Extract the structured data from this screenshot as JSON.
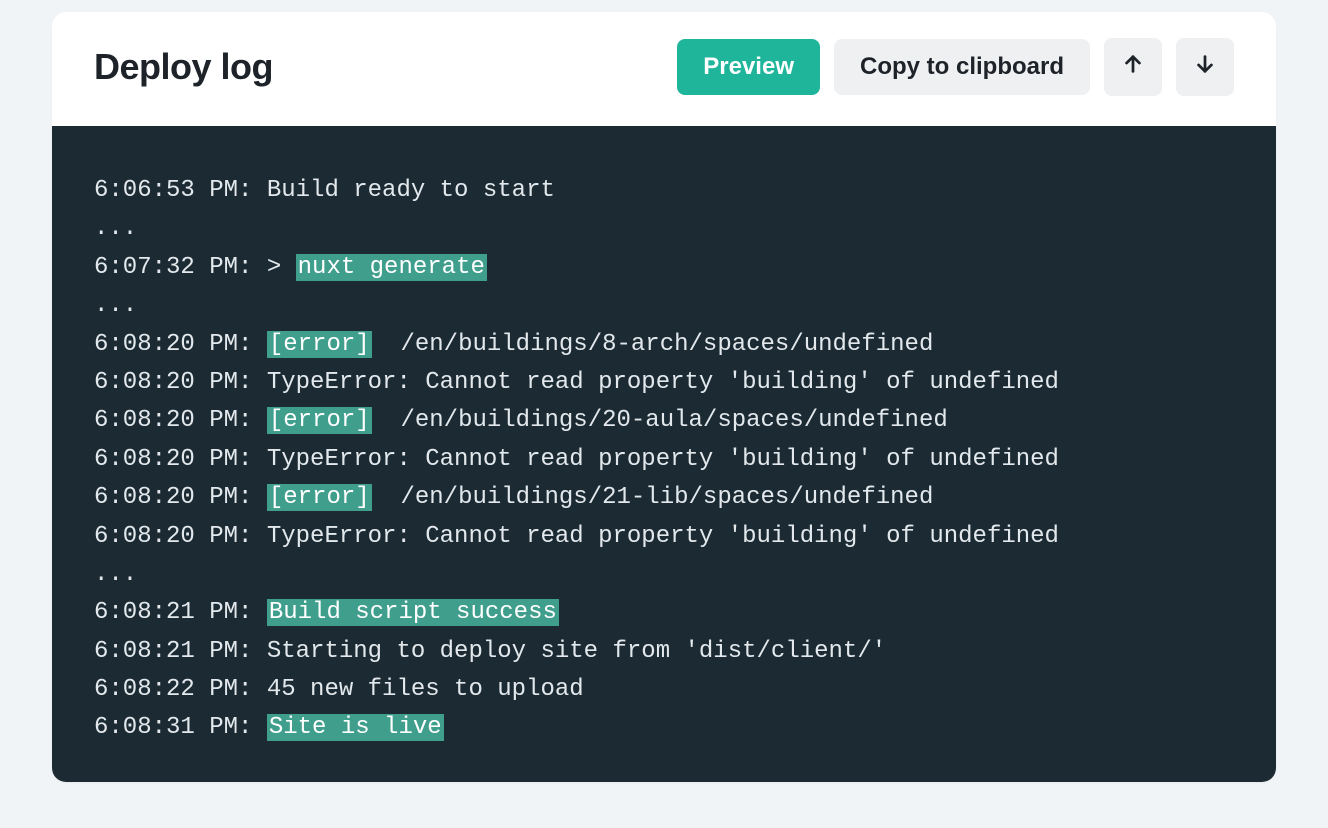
{
  "header": {
    "title": "Deploy log",
    "preview_label": "Preview",
    "copy_label": "Copy to clipboard"
  },
  "log": {
    "lines": [
      {
        "ts": "6:06:53 PM",
        "segments": [
          {
            "text": "Build ready to start"
          }
        ]
      },
      {
        "raw": "..."
      },
      {
        "ts": "6:07:32 PM",
        "segments": [
          {
            "text": "> "
          },
          {
            "text": "nuxt generate",
            "hl": true
          }
        ]
      },
      {
        "raw": ""
      },
      {
        "raw": "..."
      },
      {
        "ts": "6:08:20 PM",
        "segments": [
          {
            "text": "[error]",
            "hl": true
          },
          {
            "text": "  /en/buildings/8-arch/spaces/undefined"
          }
        ]
      },
      {
        "ts": "6:08:20 PM",
        "segments": [
          {
            "text": "TypeError: Cannot read property 'building' of undefined"
          }
        ]
      },
      {
        "ts": "6:08:20 PM",
        "segments": [
          {
            "text": "[error]",
            "hl": true
          },
          {
            "text": "  /en/buildings/20-aula/spaces/undefined"
          }
        ]
      },
      {
        "ts": "6:08:20 PM",
        "segments": [
          {
            "text": "TypeError: Cannot read property 'building' of undefined"
          }
        ]
      },
      {
        "ts": "6:08:20 PM",
        "segments": [
          {
            "text": "[error]",
            "hl": true
          },
          {
            "text": "  /en/buildings/21-lib/spaces/undefined"
          }
        ]
      },
      {
        "ts": "6:08:20 PM",
        "segments": [
          {
            "text": "TypeError: Cannot read property 'building' of undefined"
          }
        ]
      },
      {
        "raw": "..."
      },
      {
        "ts": "6:08:21 PM",
        "segments": [
          {
            "text": "Build script success",
            "hl": true
          }
        ]
      },
      {
        "ts": "6:08:21 PM",
        "segments": [
          {
            "text": "Starting to deploy site from 'dist/client/'"
          }
        ]
      },
      {
        "ts": "6:08:22 PM",
        "segments": [
          {
            "text": "45 new files to upload"
          }
        ]
      },
      {
        "ts": "6:08:31 PM",
        "segments": [
          {
            "text": "Site is live",
            "hl": true
          }
        ]
      }
    ]
  }
}
